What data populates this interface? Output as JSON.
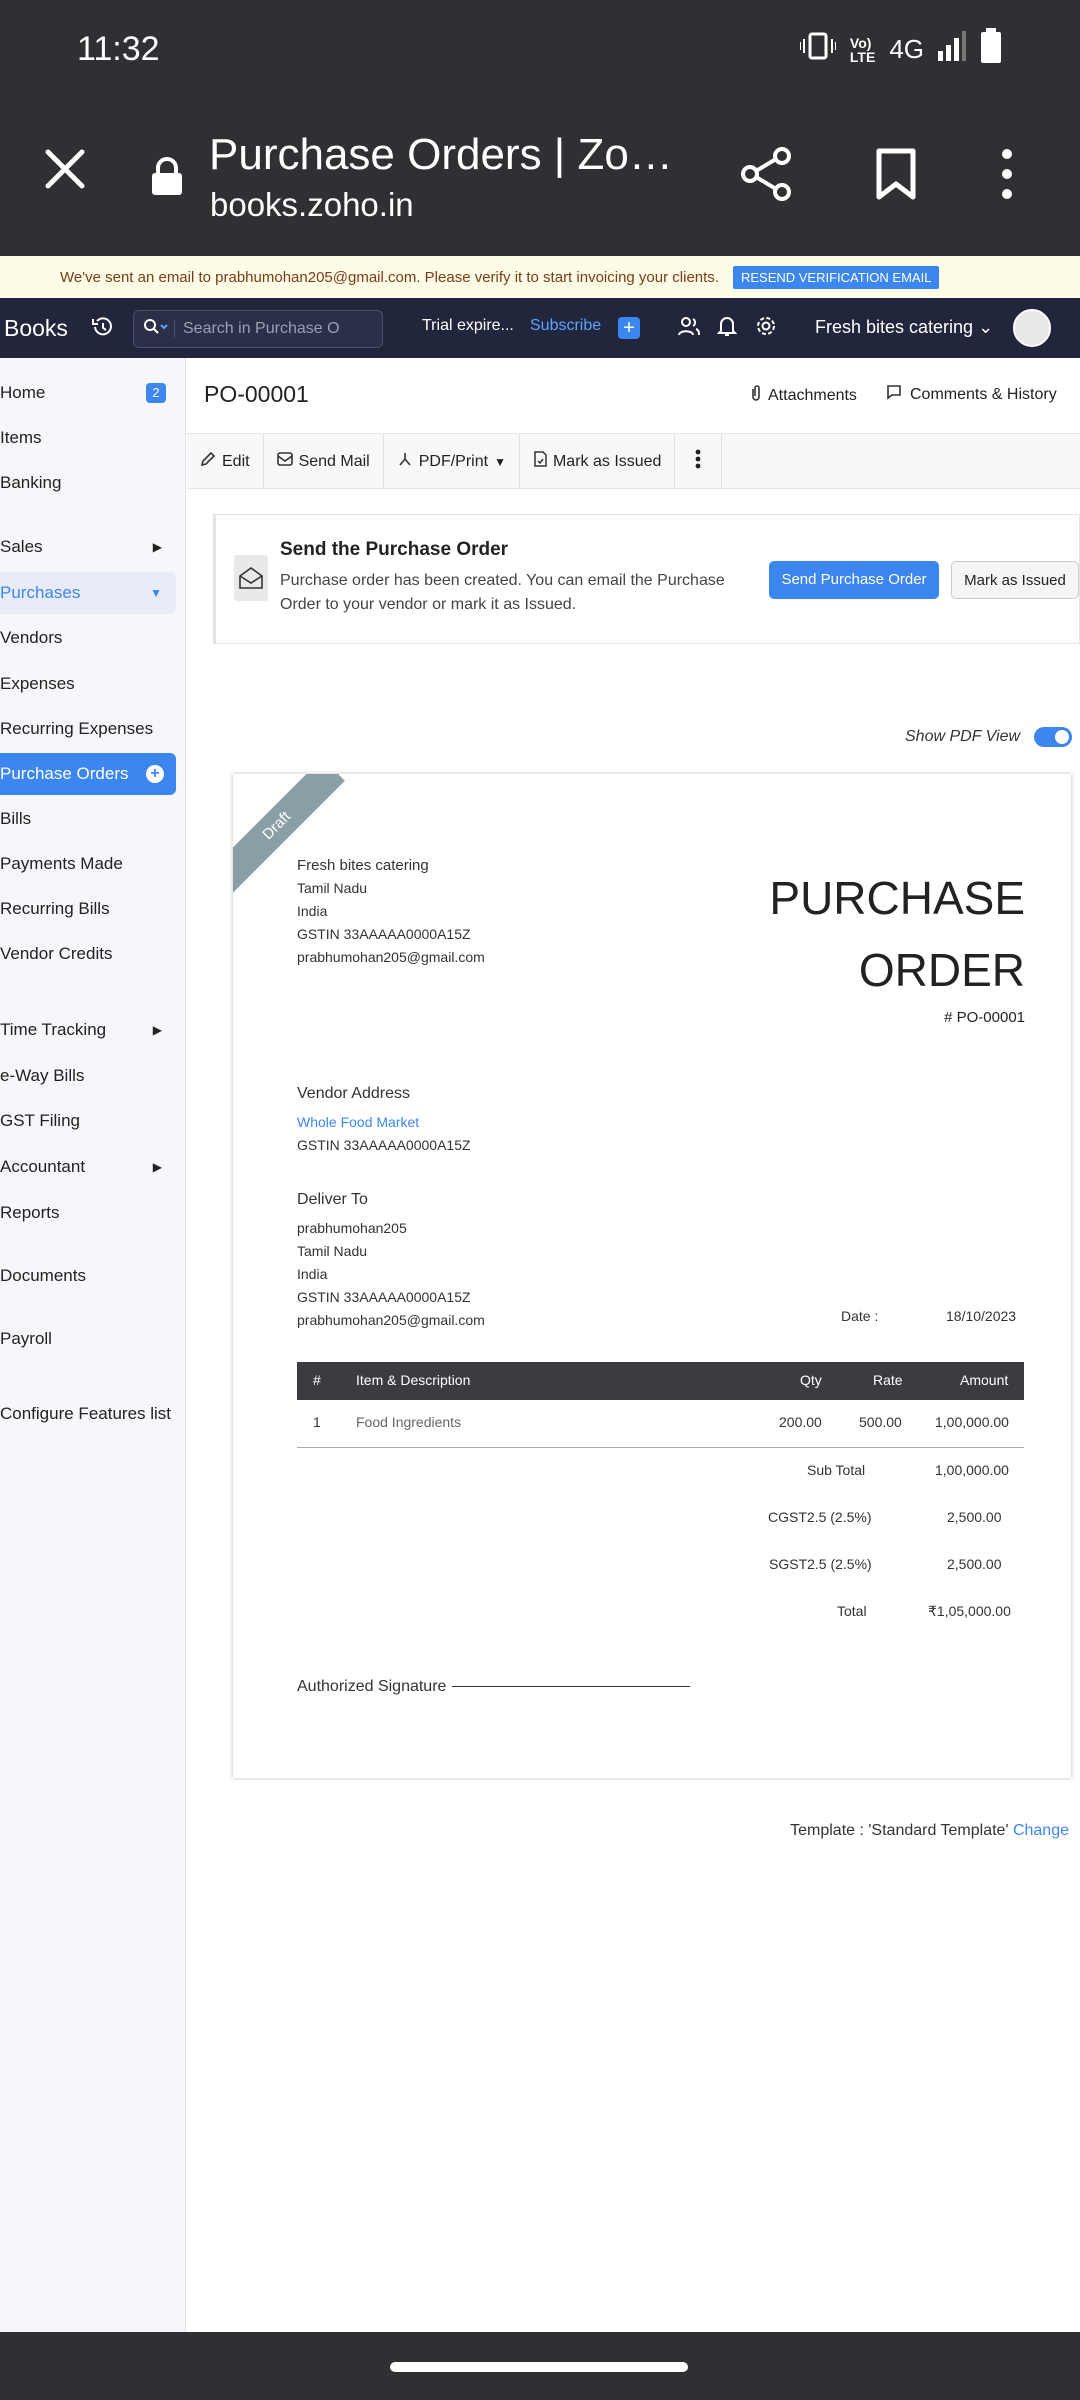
{
  "status_bar": {
    "time": "11:32",
    "network": "4G"
  },
  "browser": {
    "title": "Purchase Orders | Zoh…",
    "url": "books.zoho.in"
  },
  "banner": {
    "message": "We've sent an email to prabhumohan205@gmail.com. Please verify it to start invoicing your clients.",
    "button": "RESEND VERIFICATION EMAIL"
  },
  "topbar": {
    "brand": "Books",
    "search_placeholder": "Search in Purchase O",
    "trial": "Trial expire...",
    "subscribe": "Subscribe",
    "org": "Fresh bites catering"
  },
  "sidebar": {
    "home": "Home",
    "home_badge": "2",
    "items": "Items",
    "banking": "Banking",
    "sales": "Sales",
    "purchases": "Purchases",
    "vendors": "Vendors",
    "expenses": "Expenses",
    "recurring_expenses": "Recurring Expenses",
    "purchase_orders": "Purchase Orders",
    "bills": "Bills",
    "payments_made": "Payments Made",
    "recurring_bills": "Recurring Bills",
    "vendor_credits": "Vendor Credits",
    "time_tracking": "Time Tracking",
    "eway_bills": "e-Way Bills",
    "gst_filing": "GST Filing",
    "accountant": "Accountant",
    "reports": "Reports",
    "documents": "Documents",
    "payroll": "Payroll",
    "configure": "Configure Features list"
  },
  "header": {
    "po_number": "PO-00001",
    "attachments": "Attachments",
    "comments": "Comments & History"
  },
  "toolbar": {
    "edit": "Edit",
    "send_mail": "Send Mail",
    "pdf_print": "PDF/Print",
    "mark_issued": "Mark as Issued"
  },
  "card": {
    "title": "Send the Purchase Order",
    "text": "Purchase order has been created. You can email the Purchase Order to your vendor or mark it as Issued.",
    "primary": "Send Purchase Order",
    "secondary": "Mark as Issued"
  },
  "pdf_view_label": "Show PDF View",
  "document": {
    "ribbon": "Draft",
    "company": "Fresh bites catering",
    "company_state": "Tamil Nadu",
    "company_country": "India",
    "company_gstin": "GSTIN 33AAAAA0000A15Z",
    "company_email": "prabhumohan205@gmail.com",
    "title_line1": "PURCHASE",
    "title_line2": "ORDER",
    "number": "# PO-00001",
    "vendor_heading": "Vendor Address",
    "vendor_name": "Whole Food Market",
    "vendor_gstin": "GSTIN 33AAAAA0000A15Z",
    "deliver_heading": "Deliver To",
    "deliver_name": "prabhumohan205",
    "deliver_state": "Tamil Nadu",
    "deliver_country": "India",
    "deliver_gstin": "GSTIN 33AAAAA0000A15Z",
    "deliver_email": "prabhumohan205@gmail.com",
    "date_label": "Date :",
    "date_value": "18/10/2023",
    "columns": {
      "num": "#",
      "item": "Item & Description",
      "qty": "Qty",
      "rate": "Rate",
      "amount": "Amount"
    },
    "row": {
      "num": "1",
      "item": "Food Ingredients",
      "qty": "200.00",
      "rate": "500.00",
      "amount": "1,00,000.00"
    },
    "sub_total_label": "Sub Total",
    "sub_total": "1,00,000.00",
    "cgst_label": "CGST2.5 (2.5%)",
    "cgst": "2,500.00",
    "sgst_label": "SGST2.5 (2.5%)",
    "sgst": "2,500.00",
    "total_label": "Total",
    "total": "₹1,05,000.00",
    "signature": "Authorized Signature"
  },
  "template": {
    "label": "Template : 'Standard Template'",
    "change": "Change"
  }
}
